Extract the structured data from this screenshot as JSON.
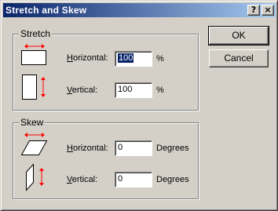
{
  "window": {
    "title": "Stretch and Skew"
  },
  "caption_buttons": {
    "help": "?",
    "close": "×"
  },
  "buttons": {
    "ok": "OK",
    "cancel": "Cancel"
  },
  "stretch": {
    "label": "Stretch",
    "horizontal": {
      "label_underlined": "H",
      "label_rest": "orizontal:",
      "value": "100",
      "unit": "%"
    },
    "vertical": {
      "label_underlined": "V",
      "label_rest": "ertical:",
      "value": "100",
      "unit": "%"
    }
  },
  "skew": {
    "label": "Skew",
    "horizontal": {
      "label_underlined": "H",
      "label_rest": "orizontal:",
      "value": "0",
      "unit": "Degrees"
    },
    "vertical": {
      "label_underlined": "V",
      "label_rest": "ertical:",
      "value": "0",
      "unit": "Degrees"
    }
  },
  "icons": {
    "stretch_horizontal": "stretch-horizontal-icon",
    "stretch_vertical": "stretch-vertical-icon",
    "skew_horizontal": "skew-horizontal-icon",
    "skew_vertical": "skew-vertical-icon"
  },
  "colors": {
    "title_active": "#0a246a",
    "arrow": "#ff0000",
    "face": "#d4d0c8"
  }
}
